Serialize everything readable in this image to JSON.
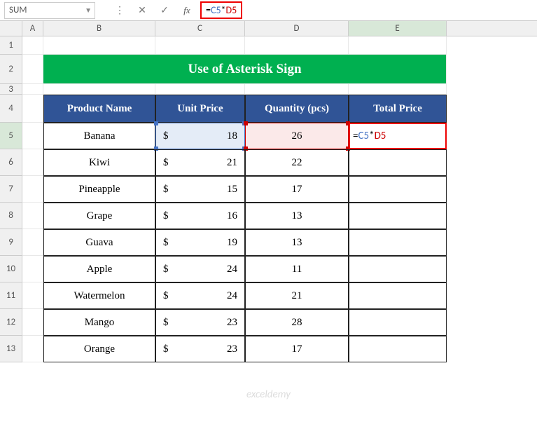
{
  "name_box": "SUM",
  "formula_bar": {
    "prefix": "=",
    "ref1": "C5",
    "op": "*",
    "ref2": "D5"
  },
  "columns": [
    "A",
    "B",
    "C",
    "D",
    "E"
  ],
  "title": "Use of Asterisk Sign",
  "headers": {
    "b": "Product Name",
    "c": "Unit Price",
    "d": "Quantity (pcs)",
    "e": "Total Price"
  },
  "currency": "$",
  "rows": [
    {
      "product": "Banana",
      "price": "18",
      "qty": "26"
    },
    {
      "product": "Kiwi",
      "price": "21",
      "qty": "22"
    },
    {
      "product": "Pineapple",
      "price": "15",
      "qty": "17"
    },
    {
      "product": "Grape",
      "price": "16",
      "qty": "13"
    },
    {
      "product": "Guava",
      "price": "19",
      "qty": "13"
    },
    {
      "product": "Apple",
      "price": "24",
      "qty": "11"
    },
    {
      "product": "Watermelon",
      "price": "24",
      "qty": "21"
    },
    {
      "product": "Mango",
      "price": "23",
      "qty": "28"
    },
    {
      "product": "Orange",
      "price": "23",
      "qty": "17"
    }
  ],
  "editing_cell": {
    "prefix": "=",
    "ref1": "C5",
    "op": "*",
    "ref2": "D5"
  },
  "watermark": "exceldemy"
}
